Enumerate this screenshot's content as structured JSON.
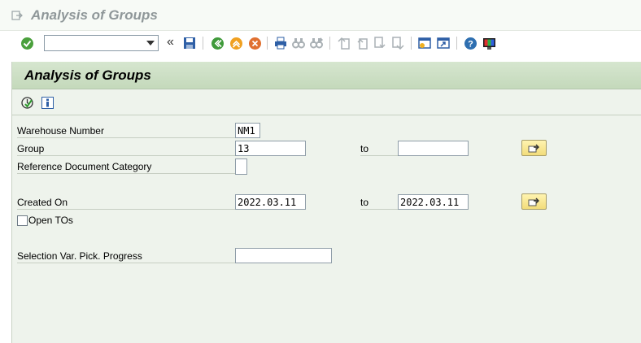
{
  "window": {
    "title": "Analysis of Groups"
  },
  "toolbar": {
    "command_value": "",
    "icons": [
      "enter-icon",
      "save-icon",
      "back-icon",
      "exit-icon",
      "cancel-icon",
      "print-icon",
      "find-icon",
      "find-next-icon",
      "first-page-icon",
      "previous-page-icon",
      "next-page-icon",
      "last-page-icon",
      "new-session-icon",
      "shortcut-icon",
      "help-icon",
      "customize-layout-icon"
    ]
  },
  "screen": {
    "title": "Analysis of Groups",
    "app_icons": [
      "execute-icon",
      "info-icon"
    ]
  },
  "form": {
    "warehouse_number": {
      "label": "Warehouse Number",
      "value": "NM1"
    },
    "group": {
      "label": "Group",
      "from": "13",
      "to_label": "to",
      "to": ""
    },
    "reference_doc_category": {
      "label": "Reference Document Category",
      "value": ""
    },
    "created_on": {
      "label": "Created On",
      "from": "2022.03.11",
      "to_label": "to",
      "to": "2022.03.11"
    },
    "open_tos": {
      "label": "Open TOs",
      "checked": false
    },
    "selection_var_pick_progress": {
      "label": "Selection Var. Pick. Progress",
      "value": ""
    }
  },
  "colors": {
    "header_green": "#c4d9bb",
    "frame_bg": "#eef3ec",
    "button_yellow": "#f2dc7a"
  }
}
